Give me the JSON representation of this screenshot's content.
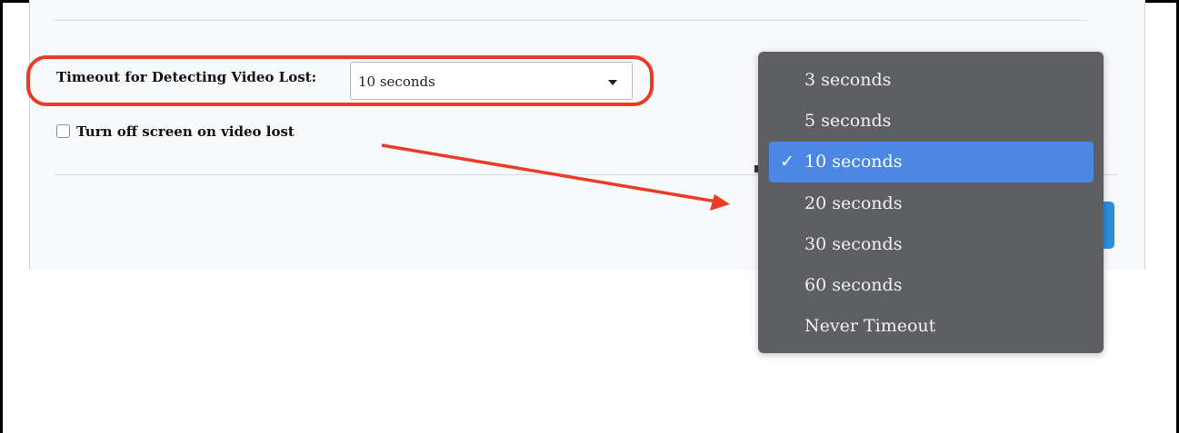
{
  "settings": {
    "timeout_label": "Timeout for Detecting Video Lost:",
    "timeout_value": "10 seconds",
    "turn_off_label": "Turn off screen on video lost",
    "turn_off_checked": false
  },
  "dropdown": {
    "options": [
      {
        "label": "3 seconds",
        "selected": false
      },
      {
        "label": "5 seconds",
        "selected": false
      },
      {
        "label": "10 seconds",
        "selected": true
      },
      {
        "label": "20 seconds",
        "selected": false
      },
      {
        "label": "30 seconds",
        "selected": false
      },
      {
        "label": "60 seconds",
        "selected": false
      },
      {
        "label": "Never Timeout",
        "selected": false
      }
    ],
    "check_glyph": "✓"
  },
  "colors": {
    "annotation": "#ea3b25",
    "dropdown_bg": "#5e5f63",
    "selected_bg": "#4b88e3"
  }
}
